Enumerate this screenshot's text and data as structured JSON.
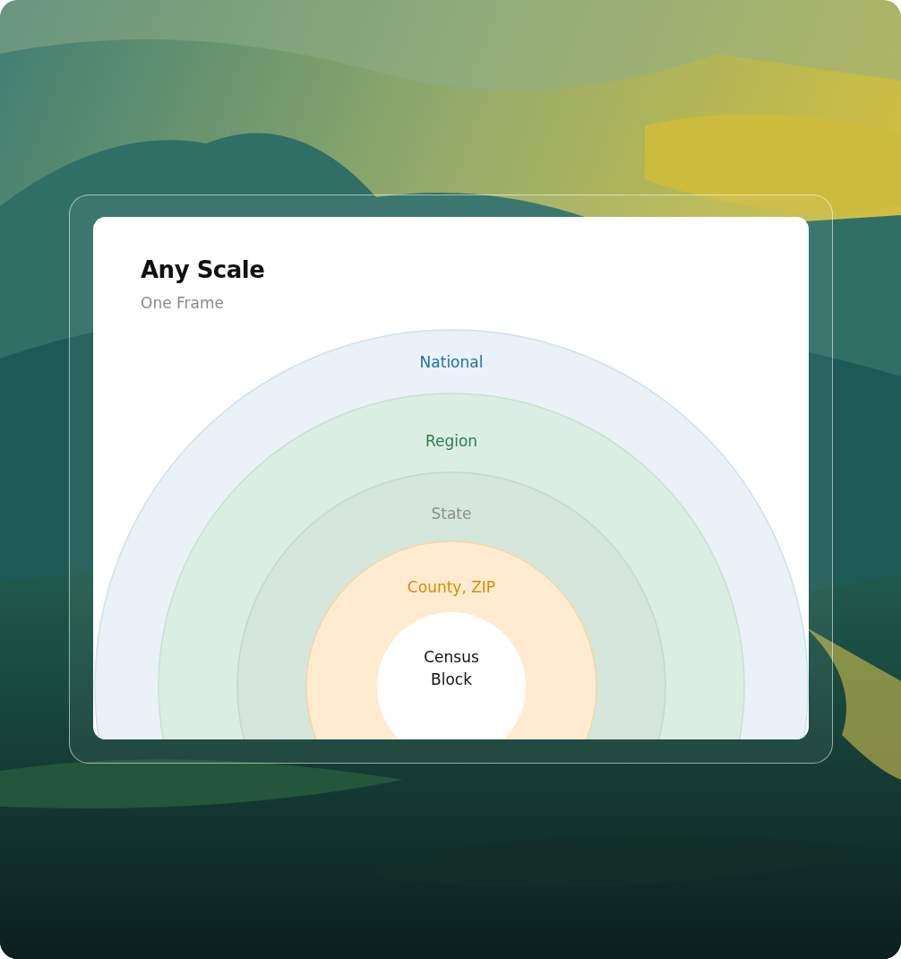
{
  "card": {
    "title": "Any Scale",
    "subtitle": "One Frame"
  },
  "rings": [
    {
      "label": "National",
      "color": "#eaf1f7"
    },
    {
      "label": "Region",
      "color": "#dbeee3"
    },
    {
      "label": "State",
      "color": "#d5e6dc"
    },
    {
      "label": "County, ZIP",
      "color": "#ffecd0"
    }
  ],
  "center": {
    "label": "Census Block",
    "color": "#ffffff"
  }
}
